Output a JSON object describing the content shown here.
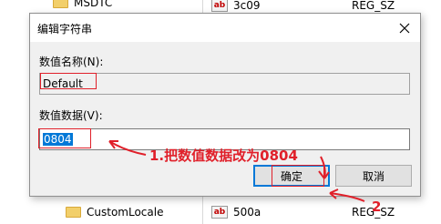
{
  "tree": {
    "items": [
      {
        "label": "MSDTC"
      },
      {
        "label": "CustomLocale"
      }
    ]
  },
  "values": {
    "rows": [
      {
        "name": "3c09",
        "type": "REG_SZ"
      },
      {
        "name": "500a",
        "type": "REG_SZ"
      }
    ]
  },
  "dialog": {
    "title": "编辑字符串",
    "name_label": "数值名称(N):",
    "name_value": "Default",
    "data_label": "数值数据(V):",
    "data_value": "0804",
    "ok_label": "确定",
    "cancel_label": "取消"
  },
  "annotation": {
    "step1": "1.把数值数据改为0804",
    "step2": "2"
  },
  "colors": {
    "annotation": "#e0202a",
    "selection": "#0078d7",
    "dialog_body": "#f0f0f0"
  }
}
